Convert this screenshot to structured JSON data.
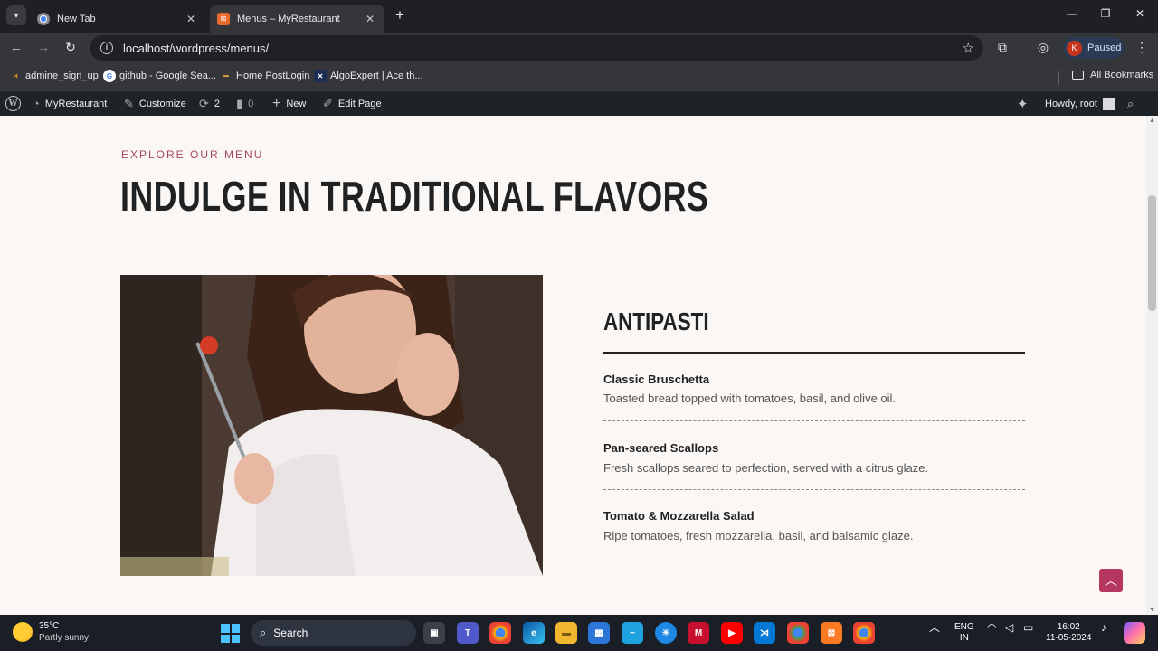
{
  "browser": {
    "tabs": [
      {
        "title": "New Tab",
        "active": false
      },
      {
        "title": "Menus – MyRestaurant",
        "active": true
      }
    ],
    "url": "localhost/wordpress/menus/",
    "profile_initial": "K",
    "profile_status": "Paused",
    "bookmarks": [
      "admine_sign_up",
      "github - Google Sea...",
      "Home PostLogin",
      "AlgoExpert | Ace th..."
    ],
    "all_bookmarks": "All Bookmarks"
  },
  "wp_admin_bar": {
    "site_name": "MyRestaurant",
    "customize": "Customize",
    "updates_count": "2",
    "comments_count": "0",
    "new": "New",
    "edit_page": "Edit Page",
    "howdy": "Howdy, root"
  },
  "page": {
    "eyebrow": "EXPLORE OUR MENU",
    "heading": "INDULGE IN TRADITIONAL FLAVORS",
    "category": "ANTIPASTI",
    "items": [
      {
        "name": "Classic Bruschetta",
        "desc": "Toasted bread topped with tomatoes, basil, and olive oil."
      },
      {
        "name": "Pan-seared Scallops",
        "desc": "Fresh scallops seared to perfection, served with a citrus glaze."
      },
      {
        "name": "Tomato & Mozzarella Salad",
        "desc": "Ripe tomatoes, fresh mozzarella, basil, and balsamic glaze."
      }
    ]
  },
  "taskbar": {
    "temperature": "35°C",
    "weather": "Partly sunny",
    "search_label": "Search",
    "lang_1": "ENG",
    "lang_2": "IN",
    "time": "16:02",
    "date": "11-05-2024"
  },
  "colors": {
    "accent": "#b5365e",
    "eyebrow": "#a4465e",
    "heading": "#1f2123",
    "chrome_dark": "#35363a"
  }
}
